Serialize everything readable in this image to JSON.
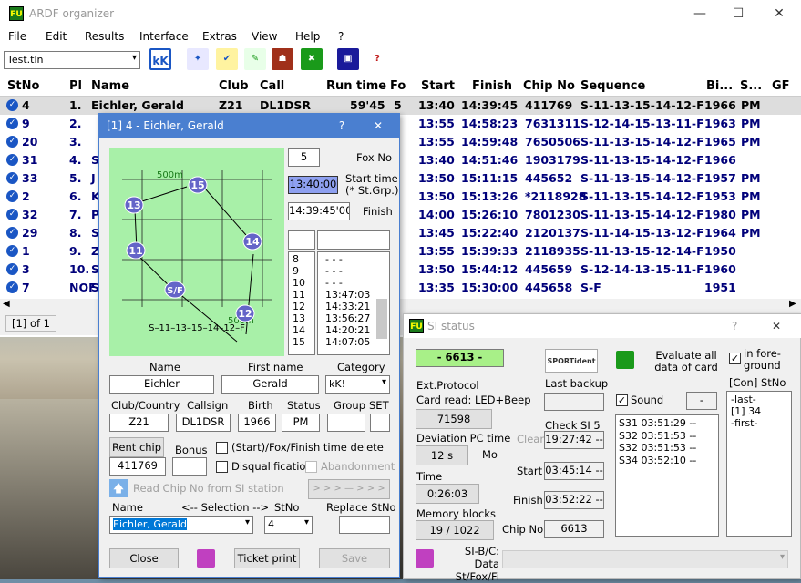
{
  "window": {
    "title": "ARDF organizer",
    "icon_text": "FU"
  },
  "menu": [
    "File",
    "Edit",
    "Results",
    "Interface",
    "Extras",
    "View",
    "Help",
    "?"
  ],
  "toolbar": {
    "file_combo": "Test.tln",
    "kk_label": "kK"
  },
  "table": {
    "headers": [
      "StNo",
      "Pl",
      "Name",
      "Club",
      "Call",
      "Run time",
      "Fo",
      "Start",
      "Finish",
      "Chip No",
      "Sequence",
      "Bi...",
      "S...",
      "GF"
    ],
    "rows": [
      {
        "stno": "4",
        "pl": "1.",
        "name": "Eichler, Gerald",
        "club": "Z21",
        "call": "DL1DSR",
        "runtime": "59'45",
        "fo": "5",
        "start": "13:40",
        "finish": "14:39:45",
        "chip": "411769",
        "seq": "S-11-13-15-14-12-F",
        "birth": "1966",
        "status": "PM"
      },
      {
        "stno": "9",
        "pl": "2.",
        "name": "",
        "club": "",
        "call": "",
        "runtime": "",
        "fo": "",
        "start": "13:55",
        "finish": "14:58:23",
        "chip": "7631311",
        "seq": "S-12-14-15-13-11-F",
        "birth": "1963",
        "status": "PM"
      },
      {
        "stno": "20",
        "pl": "3.",
        "name": "",
        "club": "",
        "call": "",
        "runtime": "",
        "fo": "",
        "start": "13:55",
        "finish": "14:59:48",
        "chip": "7650506",
        "seq": "S-11-13-15-14-12-F",
        "birth": "1965",
        "status": "PM"
      },
      {
        "stno": "31",
        "pl": "4.",
        "name": "S",
        "club": "",
        "call": "",
        "runtime": "",
        "fo": "",
        "start": "13:40",
        "finish": "14:51:46",
        "chip": "1903179",
        "seq": "S-11-13-15-14-12-F",
        "birth": "1966",
        "status": ""
      },
      {
        "stno": "33",
        "pl": "5.",
        "name": "J",
        "club": "",
        "call": "",
        "runtime": "",
        "fo": "",
        "start": "13:50",
        "finish": "15:11:15",
        "chip": "445652",
        "seq": "S-11-13-15-14-12-F",
        "birth": "1957",
        "status": "PM"
      },
      {
        "stno": "2",
        "pl": "6.",
        "name": "K",
        "club": "",
        "call": "",
        "runtime": "",
        "fo": "",
        "start": "13:50",
        "finish": "15:13:26",
        "chip": "*2118928",
        "seq": "S-11-13-15-14-12-F",
        "birth": "1953",
        "status": "PM"
      },
      {
        "stno": "32",
        "pl": "7.",
        "name": "P",
        "club": "",
        "call": "",
        "runtime": "",
        "fo": "",
        "start": "14:00",
        "finish": "15:26:10",
        "chip": "7801230",
        "seq": "S-11-13-15-14-12-F",
        "birth": "1980",
        "status": "PM"
      },
      {
        "stno": "29",
        "pl": "8.",
        "name": "S",
        "club": "",
        "call": "",
        "runtime": "",
        "fo": "",
        "start": "13:45",
        "finish": "15:22:40",
        "chip": "2120137",
        "seq": "S-11-14-15-13-12-F",
        "birth": "1964",
        "status": "PM"
      },
      {
        "stno": "1",
        "pl": "9.",
        "name": "Z",
        "club": "",
        "call": "",
        "runtime": "",
        "fo": "",
        "start": "13:55",
        "finish": "15:39:33",
        "chip": "2118935",
        "seq": "S-11-13-15-12-14-F",
        "birth": "1950",
        "status": ""
      },
      {
        "stno": "3",
        "pl": "10.",
        "name": "S",
        "club": "",
        "call": "",
        "runtime": "",
        "fo": "",
        "start": "13:50",
        "finish": "15:44:12",
        "chip": "445659",
        "seq": "S-12-14-13-15-11-F",
        "birth": "1960",
        "status": ""
      },
      {
        "stno": "7",
        "pl": "NOF",
        "name": "S",
        "club": "",
        "call": "",
        "runtime": "",
        "fo": "",
        "start": "13:35",
        "finish": "15:30:00",
        "chip": "445658",
        "seq": "S-F",
        "birth": "1951",
        "status": ""
      }
    ]
  },
  "statusbar": {
    "page": "[1] of 1"
  },
  "dialog": {
    "title": "[1] 4 - Eichler, Gerald",
    "help": "?",
    "close": "✕",
    "map": {
      "scale_top": "500m",
      "scale_bottom": "500m",
      "sequence": "S–11–13–15–14–12–F",
      "nodes": [
        "15",
        "13",
        "14",
        "11",
        "12",
        "S/F"
      ]
    },
    "fox_no_value": "5",
    "fox_no_label": "Fox No",
    "start_time_value": "13:40:00",
    "start_time_label": "Start time",
    "start_time_sub": "(* St.Grp.)",
    "finish_value": "14:39:45'00",
    "finish_label": "Finish",
    "punch_nums": [
      "8",
      "9",
      "10",
      "11",
      "12",
      "13",
      "14",
      "15"
    ],
    "punch_times": [
      "- - -",
      "- - -",
      "- - -",
      "13:47:03",
      "14:33:21",
      "13:56:27",
      "14:20:21",
      "14:07:05"
    ],
    "name_label": "Name",
    "name_value": "Eichler",
    "firstname_label": "First name",
    "firstname_value": "Gerald",
    "category_label": "Category",
    "category_value": "kK!",
    "club_label": "Club/Country",
    "club_value": "Z21",
    "callsign_label": "Callsign",
    "callsign_value": "DL1DSR",
    "birth_label": "Birth",
    "birth_value": "1966",
    "status_label": "Status",
    "status_value": "PM",
    "group_label": "Group",
    "group_value": "",
    "set_label": "SET",
    "set_value": "",
    "rent_chip": "Rent chip",
    "bonus_label": "Bonus",
    "chip_value": "411769",
    "bonus_value": "",
    "cb_start_fox": "(Start)/Fox/Finish time delete",
    "cb_disq": "Disqualification",
    "cb_abandon": "Abandonment",
    "read_chip": "Read Chip No from SI station",
    "arrows_btn": "> > > — > > >",
    "sel_name_label": "Name",
    "selection_label": "<-- Selection -->",
    "sel_stno_label": "StNo",
    "replace_label": "Replace StNo",
    "sel_name_value": "Eichler, Gerald",
    "sel_stno_value": "4",
    "close_btn": "Close",
    "ticket_btn": "Ticket print",
    "save_btn": "Save"
  },
  "si": {
    "title": "SI status",
    "help": "?",
    "close": "✕",
    "station_value": "- 6613 -",
    "logo_text": "SPORTident",
    "evaluate_label": "Evaluate all data of card",
    "foreground_label": "in fore-ground",
    "ext_protocol": "Ext.Protocol",
    "card_read": "Card read: LED+Beep",
    "last_backup": "Last backup",
    "sound_label": "Sound",
    "dash_value": "-",
    "con_label": "[Con]",
    "stno_label": "StNo",
    "con_list": [
      "-last-",
      "[1]  34",
      "-first-"
    ],
    "serial_value": "71598",
    "check_si5": "Check SI 5",
    "deviation_label": "Deviation PC time",
    "deviation_value": "12 s",
    "mo_label": "Mo",
    "clear_label": "Clear",
    "clear_value": "19:27:42 --",
    "time_label": "Time",
    "time_value": "0:26:03",
    "start_label": "Start",
    "start_value": "03:45:14 --",
    "finish_label": "Finish",
    "finish_value": "03:52:22 --",
    "memory_label": "Memory blocks",
    "memory_value": "19 / 1022",
    "chipno_label": "Chip No",
    "chipno_value": "6613",
    "punches": [
      "S31   03:51:29 --",
      "S32   03:51:53 --",
      "S32   03:51:53 --",
      "S34   03:52:10 --"
    ],
    "sibc_label": "SI-B/C: Data St/Fox/Fi"
  },
  "colors": {
    "accent_blue": "#1a56c4",
    "dialog_border": "#4a7fd0",
    "map_bg": "#a8f0a8",
    "node_fill": "#6464c8"
  }
}
